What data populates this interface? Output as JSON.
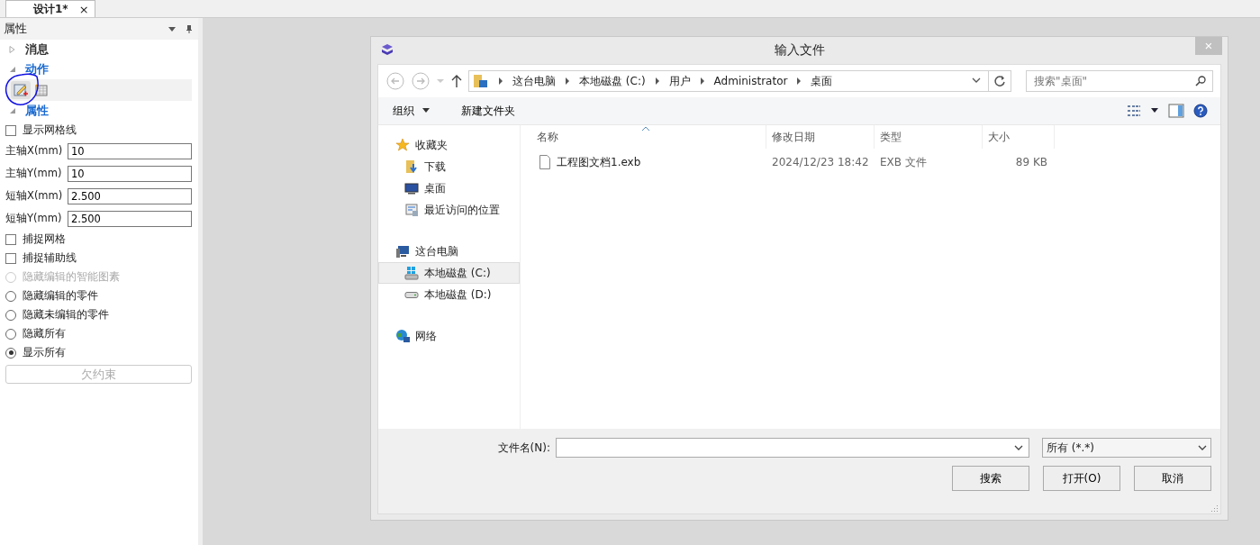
{
  "tab": {
    "title": "设计1*",
    "close": "×"
  },
  "panel": {
    "title": "属性",
    "sections": [
      {
        "kind": "message",
        "title": "消息",
        "expanded": false
      },
      {
        "kind": "action",
        "title": "动作",
        "expanded": true
      },
      {
        "kind": "properties",
        "title": "属性",
        "expanded": true
      }
    ],
    "properties": [
      {
        "kind": "checkbox",
        "label": "显示网格线",
        "checked": false
      },
      {
        "kind": "field",
        "label": "主轴X(mm)",
        "value": "10"
      },
      {
        "kind": "field",
        "label": "主轴Y(mm)",
        "value": "10"
      },
      {
        "kind": "field",
        "label": "短轴X(mm)",
        "value": "2.500"
      },
      {
        "kind": "field",
        "label": "短轴Y(mm)",
        "value": "2.500"
      },
      {
        "kind": "checkbox",
        "label": "捕捉网格",
        "checked": false
      },
      {
        "kind": "checkbox",
        "label": "捕捉辅助线",
        "checked": false
      },
      {
        "kind": "radio",
        "label": "隐藏编辑的智能图素",
        "selected": false,
        "disabled": true
      },
      {
        "kind": "radio",
        "label": "隐藏编辑的零件",
        "selected": false,
        "disabled": false
      },
      {
        "kind": "radio",
        "label": "隐藏未编辑的零件",
        "selected": false,
        "disabled": false
      },
      {
        "kind": "radio",
        "label": "隐藏所有",
        "selected": false,
        "disabled": false
      },
      {
        "kind": "radio",
        "label": "显示所有",
        "selected": true,
        "disabled": false
      },
      {
        "kind": "button",
        "label": "欠约束",
        "disabled": true
      }
    ]
  },
  "dialog": {
    "title": "输入文件",
    "close": "×",
    "breadcrumbs": [
      "这台电脑",
      "本地磁盘 (C:)",
      "用户",
      "Administrator",
      "桌面"
    ],
    "search": {
      "placeholder": "搜索\"桌面\""
    },
    "toolbar": {
      "organize": "组织",
      "new_folder": "新建文件夹"
    },
    "nav": [
      {
        "label": "收藏夹",
        "kind": "favorites",
        "selected": false,
        "children": [
          {
            "label": "下载",
            "kind": "download",
            "selected": false
          },
          {
            "label": "桌面",
            "kind": "desktop",
            "selected": false
          },
          {
            "label": "最近访问的位置",
            "kind": "recent",
            "selected": false
          }
        ]
      },
      {
        "label": "这台电脑",
        "kind": "computer",
        "selected": false,
        "children": [
          {
            "label": "本地磁盘 (C:)",
            "kind": "windrive",
            "selected": true
          },
          {
            "label": "本地磁盘 (D:)",
            "kind": "drive",
            "selected": false
          }
        ]
      },
      {
        "label": "网络",
        "kind": "network",
        "selected": false
      }
    ],
    "columns": [
      "名称",
      "修改日期",
      "类型",
      "大小"
    ],
    "rows": [
      {
        "name": "工程图文档1.exb",
        "modified": "2024/12/23 18:42",
        "type": "EXB 文件",
        "size": "89 KB"
      }
    ],
    "filename_label": "文件名(N):",
    "filter": "所有 (*.*)",
    "buttons": [
      "搜索",
      "打开(O)",
      "取消"
    ]
  }
}
